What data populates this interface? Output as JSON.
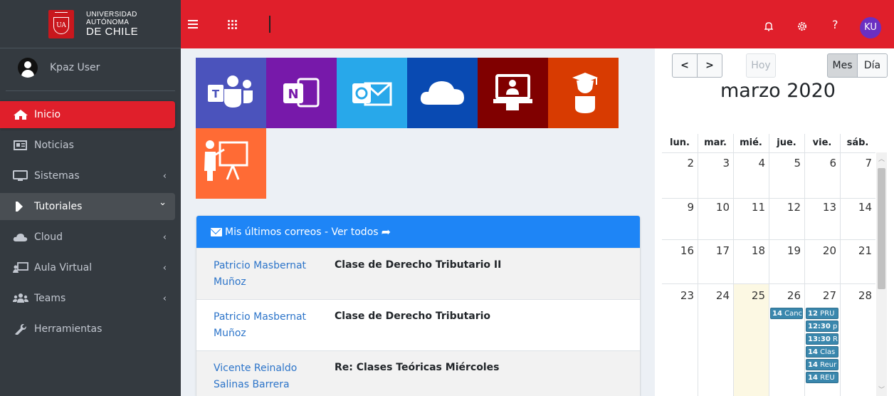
{
  "brand": {
    "line1": "UNIVERSIDAD",
    "line2": "AUTÓNOMA",
    "line3": "DE CHILE",
    "logo_text": "UA"
  },
  "user": {
    "name": "Kpaz User",
    "initials": "KU"
  },
  "sidebar": {
    "items": [
      {
        "label": "Inicio",
        "icon": "home-icon",
        "state": "active",
        "chevron": ""
      },
      {
        "label": "Noticias",
        "icon": "newspaper-icon",
        "state": "",
        "chevron": ""
      },
      {
        "label": "Sistemas",
        "icon": "desktop-icon",
        "state": "",
        "chevron": "‹"
      },
      {
        "label": "Tutoriales",
        "icon": "play-bookmark-icon",
        "state": "open",
        "chevron": "⌄"
      },
      {
        "label": "Cloud",
        "icon": "cloud-icon",
        "state": "",
        "chevron": "‹"
      },
      {
        "label": "Aula Virtual",
        "icon": "chalkboard-teacher-icon",
        "state": "",
        "chevron": "‹"
      },
      {
        "label": "Teams",
        "icon": "users-icon",
        "state": "",
        "chevron": "‹"
      },
      {
        "label": "Herramientas",
        "icon": "wrench-icon",
        "state": "",
        "chevron": ""
      }
    ]
  },
  "topbar": {
    "bell": "♫",
    "gear": "⚙",
    "help": "?"
  },
  "tiles": [
    {
      "name": "teams",
      "color": "#4b53bc"
    },
    {
      "name": "onenote",
      "color": "#7719aa"
    },
    {
      "name": "outlook",
      "color": "#28a8ea"
    },
    {
      "name": "onedrive",
      "color": "#094ab2"
    },
    {
      "name": "virtual-class",
      "color": "#800000"
    },
    {
      "name": "graduate",
      "color": "#d83b01"
    },
    {
      "name": "presentation",
      "color": "#ff6b35"
    }
  ],
  "mail": {
    "header": "Mis últimos correos - Ver todos",
    "rows": [
      {
        "from": "Patricio Masbernat Muñoz",
        "subject": "Clase de Derecho Tributario II"
      },
      {
        "from": "Patricio Masbernat Muñoz",
        "subject": "Clase de Derecho Tributario"
      },
      {
        "from": "Vicente Reinaldo Salinas Barrera",
        "subject": "Re: Clases Teóricas Miércoles"
      }
    ]
  },
  "calendar": {
    "prev": "<",
    "next": ">",
    "today_btn": "Hoy",
    "month_btn": "Mes",
    "day_btn": "Día",
    "title": "marzo 2020",
    "dow": [
      "lun.",
      "mar.",
      "mié.",
      "jue.",
      "vie.",
      "sáb."
    ],
    "weeks": [
      [
        "2",
        "3",
        "4",
        "5",
        "6",
        "7"
      ],
      [
        "9",
        "10",
        "11",
        "12",
        "13",
        "14"
      ],
      [
        "16",
        "17",
        "18",
        "19",
        "20",
        "21"
      ],
      [
        "23",
        "24",
        "25",
        "26",
        "27",
        "28"
      ]
    ],
    "today": "25",
    "events_thu": [
      {
        "time": "14",
        "title": "Canc"
      }
    ],
    "events_fri": [
      {
        "time": "12",
        "title": "PRU"
      },
      {
        "time": "12:30",
        "title": "p"
      },
      {
        "time": "13:30",
        "title": "R"
      },
      {
        "time": "14",
        "title": "Clas"
      },
      {
        "time": "14",
        "title": "Reur"
      },
      {
        "time": "14",
        "title": "REU"
      }
    ]
  }
}
